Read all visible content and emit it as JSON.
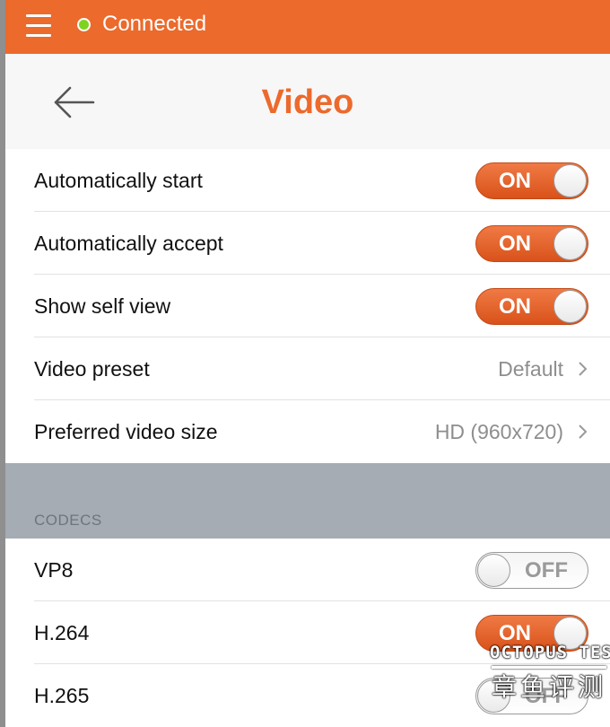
{
  "status_bar": {
    "connection_text": "Connected",
    "connection_color": "#7ed321",
    "background_color": "#ec6a2c"
  },
  "header": {
    "title": "Video",
    "back_icon": "arrow-left-icon"
  },
  "settings": [
    {
      "label": "Automatically start",
      "control": "toggle",
      "state": "ON"
    },
    {
      "label": "Automatically accept",
      "control": "toggle",
      "state": "ON"
    },
    {
      "label": "Show self view",
      "control": "toggle",
      "state": "ON"
    },
    {
      "label": "Video preset",
      "control": "disclosure",
      "value": "Default"
    },
    {
      "label": "Preferred video size",
      "control": "disclosure",
      "value": "HD (960x720)"
    }
  ],
  "codecs": {
    "section_title": "CODECS",
    "items": [
      {
        "label": "VP8",
        "control": "toggle",
        "state": "OFF"
      },
      {
        "label": "H.264",
        "control": "toggle",
        "state": "ON"
      },
      {
        "label": "H.265",
        "control": "toggle",
        "state": "OFF"
      }
    ]
  },
  "watermark": {
    "brand_en": "OCTOPUS TEST",
    "brand_cn": "章鱼评测"
  },
  "accent_color": "#ec6a2c"
}
